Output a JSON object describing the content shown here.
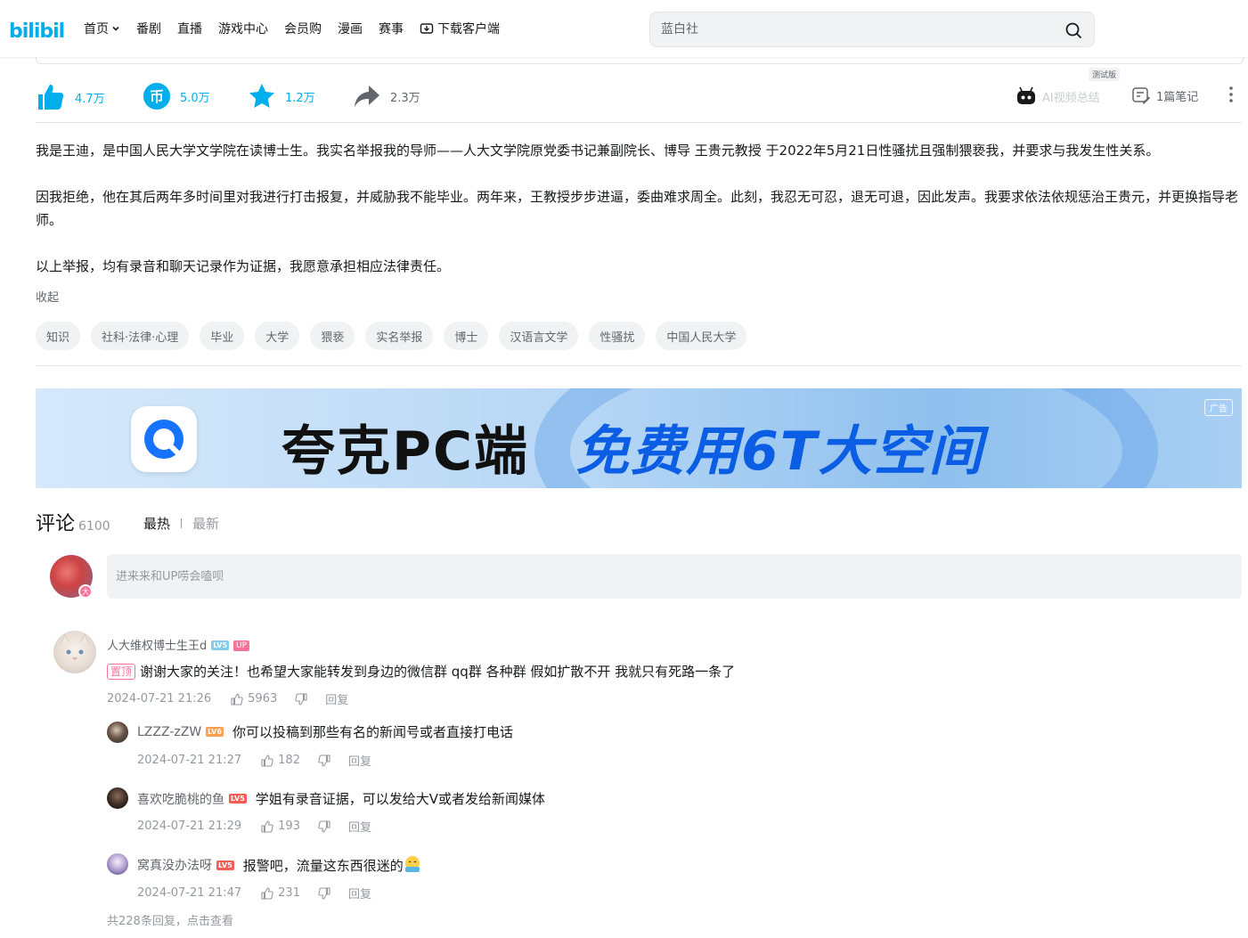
{
  "header": {
    "logo_text": "bilibili",
    "nav": [
      "首页",
      "番剧",
      "直播",
      "游戏中心",
      "会员购",
      "漫画",
      "赛事",
      "下载客户端"
    ],
    "search_placeholder": "蓝白社"
  },
  "toolbar": {
    "like": "4.7万",
    "coin": "5.0万",
    "favorite": "1.2万",
    "share": "2.3万",
    "ai_summary": "AI视频总结",
    "beta": "测试版",
    "notes": "1篇笔记"
  },
  "description": {
    "p1": "我是王迪，是中国人民大学文学院在读博士生。我实名举报我的导师——人大文学院原党委书记兼副院长、博导 王贵元教授 于2022年5月21日性骚扰且强制猥亵我，并要求与我发生性关系。",
    "p2": "因我拒绝，他在其后两年多时间里对我进行打击报复，并威胁我不能毕业。两年来，王教授步步进逼，委曲难求周全。此刻，我忍无可忍，退无可退，因此发声。我要求依法依规惩治王贵元，并更换指导老师。",
    "p3": "以上举报，均有录音和聊天记录作为证据，我愿意承担相应法律责任。",
    "collapse": "收起"
  },
  "tags": [
    "知识",
    "社科·法律·心理",
    "毕业",
    "大学",
    "猥亵",
    "实名举报",
    "博士",
    "汉语言文学",
    "性骚扰",
    "中国人民大学"
  ],
  "banner": {
    "text_left": "夸克PC端",
    "text_right": "免费用6T大空间",
    "ad_label": "广告"
  },
  "comments": {
    "title": "评论",
    "count": "6100",
    "sort_hot": "最热",
    "sort_new": "最新",
    "input_placeholder": "进来来和UP唠会嗑呗",
    "root": {
      "username": "人大维权博士生王d",
      "level": "LV5",
      "up_badge": "UP",
      "pin": "置顶",
      "content": "谢谢大家的关注！也希望大家能转发到身边的微信群 qq群 各种群 假如扩散不开 我就只有死路一条了",
      "time": "2024-07-21 21:26",
      "likes": "5963",
      "reply_label": "回复"
    },
    "replies": [
      {
        "username": "LZZZ-zZW",
        "level": "LV6",
        "content": "你可以投稿到那些有名的新闻号或者直接打电话",
        "time": "2024-07-21 21:27",
        "likes": "182",
        "reply_label": "回复"
      },
      {
        "username": "喜欢吃脆桃的鱼",
        "level": "LV5",
        "content": "学姐有录音证据，可以发给大V或者发给新闻媒体",
        "time": "2024-07-21 21:29",
        "likes": "193",
        "reply_label": "回复"
      },
      {
        "username": "窝真没办法呀",
        "level": "LV5",
        "content": "报警吧，流量这东西很迷的",
        "time": "2024-07-21 21:47",
        "likes": "231",
        "reply_label": "回复"
      }
    ],
    "view_more": "共228条回复，点击查看"
  }
}
